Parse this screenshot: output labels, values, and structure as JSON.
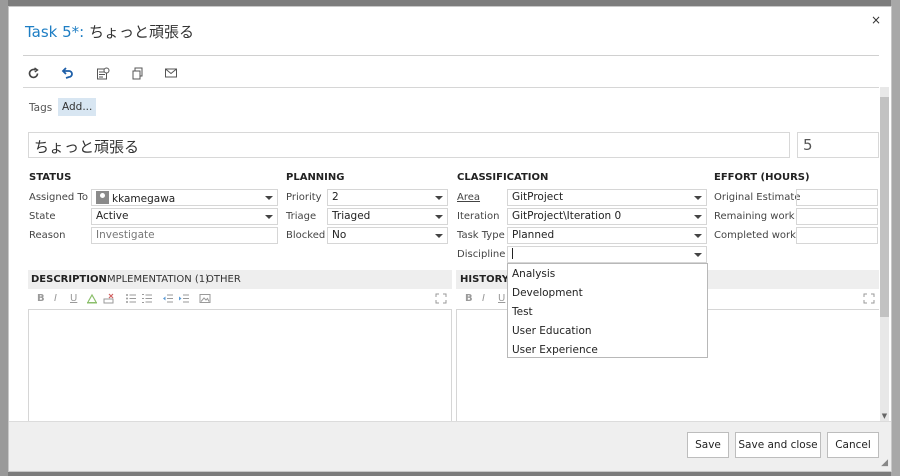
{
  "dialog": {
    "title_link": "Task 5*:",
    "title_text": "ちょっと頑張る",
    "close_label": "×"
  },
  "toolbar": {
    "icons": [
      "refresh-icon",
      "undo-icon",
      "history-icon",
      "copy-icon",
      "email-icon"
    ]
  },
  "tags": {
    "label": "Tags",
    "add_label": "Add..."
  },
  "work_item": {
    "title": "ちょっと頑張る",
    "id": "5"
  },
  "status": {
    "heading": "STATUS",
    "assigned_to_label": "Assigned To",
    "assigned_to_value": "kkamegawa",
    "state_label": "State",
    "state_value": "Active",
    "reason_label": "Reason",
    "reason_value": "Investigate"
  },
  "planning": {
    "heading": "PLANNING",
    "priority_label": "Priority",
    "priority_value": "2",
    "triage_label": "Triage",
    "triage_value": "Triaged",
    "blocked_label": "Blocked",
    "blocked_value": "No"
  },
  "classification": {
    "heading": "CLASSIFICATION",
    "area_label": "Area",
    "area_value": "GitProject",
    "iteration_label": "Iteration",
    "iteration_value": "GitProject\\Iteration 0",
    "task_type_label": "Task Type",
    "task_type_value": "Planned",
    "discipline_label": "Discipline",
    "discipline_value": ""
  },
  "effort": {
    "heading": "EFFORT (HOURS)",
    "original_label": "Original Estimate",
    "remaining_label": "Remaining work",
    "completed_label": "Completed work"
  },
  "tabs": {
    "description": "DESCRIPTION",
    "implementation": "IMPLEMENTATION (1)",
    "other": "OTHER",
    "history": "HISTORY"
  },
  "discipline_options": [
    "Analysis",
    "Development",
    "Test",
    "User Education",
    "User Experience"
  ],
  "footer": {
    "save_label": "Save",
    "save_close_label": "Save and close",
    "cancel_label": "Cancel"
  },
  "colors": {
    "link": "#1e7ec4",
    "tag_bg": "#d8e6f2"
  }
}
